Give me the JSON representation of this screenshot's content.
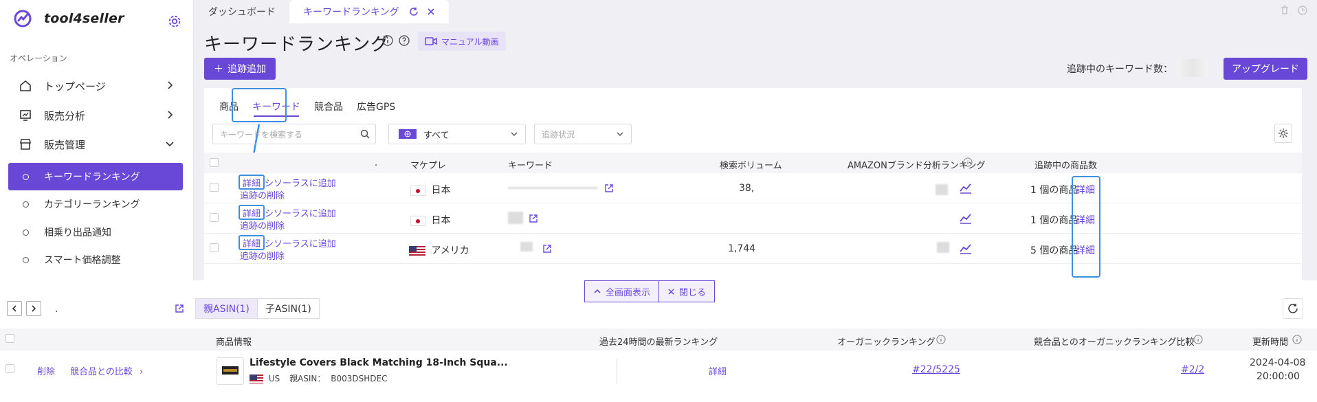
{
  "brand": {
    "name": "tool4seller"
  },
  "sidebar": {
    "section_label": "オペレーション",
    "nav": [
      {
        "label": "トップページ",
        "icon": "home-icon"
      },
      {
        "label": "販売分析",
        "icon": "chart-icon"
      },
      {
        "label": "販売管理",
        "icon": "store-icon"
      }
    ],
    "sub_items": [
      {
        "label": "キーワードランキング",
        "active": true
      },
      {
        "label": "カテゴリーランキング",
        "active": false
      },
      {
        "label": "相乗り出品通知",
        "active": false
      },
      {
        "label": "スマート価格調整",
        "active": false
      }
    ]
  },
  "tabs": [
    {
      "label": "ダッシュボード"
    },
    {
      "label": "キーワードランキング"
    }
  ],
  "page": {
    "title": "キーワードランキング",
    "manual_label": "マニュアル動画",
    "add_label": "追跡追加",
    "kw_count_label": "追跡中のキーワード数：",
    "upgrade_label": "アップグレード"
  },
  "subtabs": [
    "商品",
    "キーワード",
    "競合品",
    "広告GPS"
  ],
  "filters": {
    "search_placeholder": "キーワードを検索する",
    "market_value": "すべて",
    "status_placeholder": "追跡状況"
  },
  "table": {
    "headers": {
      "dot": ".",
      "market": "マケプレ",
      "keyword": "キーワード",
      "volume": "検索ボリューム",
      "brand_rank": "AMAZONブランド分析ランキング",
      "tracked": "追跡中の商品数"
    },
    "rows": [
      {
        "detail": "詳細",
        "thesaurus": "シソーラスに追加",
        "delete": "追跡の削除",
        "market": "日本",
        "flag": "jp",
        "volume": "38,",
        "tracked": "1 個の商品",
        "tracked_detail": "詳細"
      },
      {
        "detail": "詳細",
        "thesaurus": "シソーラスに追加",
        "delete": "追跡の削除",
        "market": "日本",
        "flag": "jp",
        "volume": "",
        "tracked": "1 個の商品",
        "tracked_detail": "詳細"
      },
      {
        "detail": "詳細",
        "thesaurus": "シソーラスに追加",
        "delete": "追跡の削除",
        "market": "アメリカ",
        "flag": "us",
        "volume": "1,744",
        "tracked": "5 個の商品",
        "tracked_detail": "詳細"
      }
    ]
  },
  "panel_controls": {
    "fullscreen": "全画面表示",
    "close": "閉じる"
  },
  "bottom": {
    "dot": ".",
    "tab_parent": "親ASIN(1)",
    "tab_child": "子ASIN(1)",
    "headers": {
      "product": "商品情報",
      "latest": "過去24時間の最新ランキング",
      "organic": "オーガニックランキング",
      "compare": "競合品とのオーガニックランキング比較",
      "updated": "更新時間"
    },
    "row": {
      "delete": "削除",
      "compare": "競合品との比較",
      "title": "Lifestyle Covers Black Matching 18-Inch Squa...",
      "country": "US",
      "asin_label": "親ASIN：",
      "asin": "B003DSHDEC",
      "latest": "詳細",
      "organic": "#22/5225",
      "compare_rank": "#2/2",
      "date": "2024-04-08",
      "time": "20:00:00"
    }
  },
  "colors": {
    "accent": "#6a48d7",
    "highlight": "#3d8fe0"
  }
}
